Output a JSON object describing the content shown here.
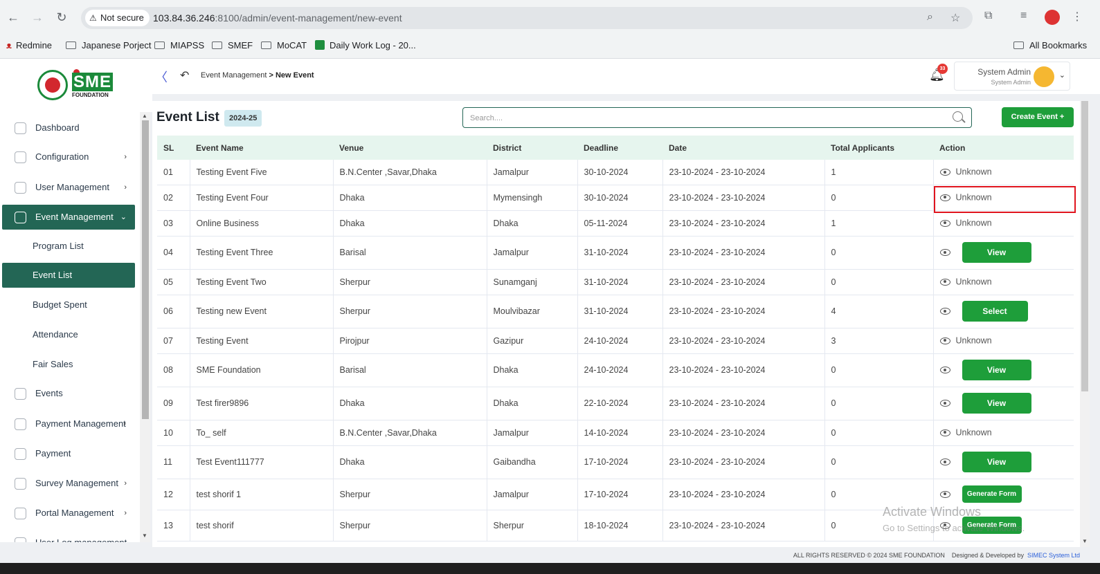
{
  "browser": {
    "not_secure": "Not secure",
    "url_host": "103.84.36.246",
    "url_path": ":8100/admin/event-management/new-event",
    "bookmarks": [
      "Redmine",
      "Japanese Porject",
      "MIAPSS",
      "SMEF",
      "MoCAT",
      "Daily Work Log - 20...",
      "All Bookmarks"
    ]
  },
  "logo": {
    "brand": "SME",
    "subtitle": "FOUNDATION"
  },
  "topbar": {
    "breadcrumb_parent": "Event Management",
    "breadcrumb_sep": ">",
    "breadcrumb_current": "New Event",
    "notification_count": "33",
    "user_name": "System Admin",
    "user_role": "System Admin"
  },
  "sidebar": {
    "items": [
      {
        "label": "Dashboard",
        "chevron": ""
      },
      {
        "label": "Configuration",
        "chevron": "›"
      },
      {
        "label": "User Management",
        "chevron": "›"
      },
      {
        "label": "Event Management",
        "chevron": "⌄"
      },
      {
        "label": "Events",
        "chevron": ""
      },
      {
        "label": "Payment Management",
        "chevron": "›"
      },
      {
        "label": "Payment",
        "chevron": ""
      },
      {
        "label": "Survey Management",
        "chevron": "›"
      },
      {
        "label": "Portal Management",
        "chevron": "›"
      },
      {
        "label": "User Log management",
        "chevron": ""
      }
    ],
    "subitems": [
      "Program List",
      "Event List",
      "Budget Spent",
      "Attendance",
      "Fair Sales"
    ]
  },
  "main": {
    "title": "Event List",
    "year_badge": "2024-25",
    "search_placeholder": "Search....",
    "create_button": "Create Event +",
    "columns": [
      "SL",
      "Event Name",
      "Venue",
      "District",
      "Deadline",
      "Date",
      "Total Applicants",
      "Action"
    ],
    "rows": [
      {
        "sl": "01",
        "name": "Testing Event Five",
        "venue": "B.N.Center ,Savar,Dhaka",
        "district": "Jamalpur",
        "deadline": "30-10-2024",
        "date": "23-10-2024 - 23-10-2024",
        "applicants": "1",
        "action": "Unknown",
        "action_type": "text"
      },
      {
        "sl": "02",
        "name": "Testing Event Four",
        "venue": "Dhaka",
        "district": "Mymensingh",
        "deadline": "30-10-2024",
        "date": "23-10-2024 - 23-10-2024",
        "applicants": "0",
        "action": "Unknown",
        "action_type": "text"
      },
      {
        "sl": "03",
        "name": "Online Business",
        "venue": "Dhaka",
        "district": "Dhaka",
        "deadline": "05-11-2024",
        "date": "23-10-2024 - 23-10-2024",
        "applicants": "1",
        "action": "Unknown",
        "action_type": "text"
      },
      {
        "sl": "04",
        "name": "Testing Event Three",
        "venue": "Barisal",
        "district": "Jamalpur",
        "deadline": "31-10-2024",
        "date": "23-10-2024 - 23-10-2024",
        "applicants": "0",
        "action": "View",
        "action_type": "button"
      },
      {
        "sl": "05",
        "name": "Testing Event Two",
        "venue": "Sherpur",
        "district": "Sunamganj",
        "deadline": "31-10-2024",
        "date": "23-10-2024 - 23-10-2024",
        "applicants": "0",
        "action": "Unknown",
        "action_type": "text"
      },
      {
        "sl": "06",
        "name": "Testing new Event",
        "venue": "Sherpur",
        "district": "Moulvibazar",
        "deadline": "31-10-2024",
        "date": "23-10-2024 - 23-10-2024",
        "applicants": "4",
        "action": "Select",
        "action_type": "button"
      },
      {
        "sl": "07",
        "name": "Testing Event",
        "venue": "Pirojpur",
        "district": "Gazipur",
        "deadline": "24-10-2024",
        "date": "23-10-2024 - 23-10-2024",
        "applicants": "3",
        "action": "Unknown",
        "action_type": "text"
      },
      {
        "sl": "08",
        "name": "SME Foundation",
        "venue": "Barisal",
        "district": "Dhaka",
        "deadline": "24-10-2024",
        "date": "23-10-2024 - 23-10-2024",
        "applicants": "0",
        "action": "View",
        "action_type": "button"
      },
      {
        "sl": "09",
        "name": "Test firer9896",
        "venue": "Dhaka",
        "district": "Dhaka",
        "deadline": "22-10-2024",
        "date": "23-10-2024 - 23-10-2024",
        "applicants": "0",
        "action": "View",
        "action_type": "button"
      },
      {
        "sl": "10",
        "name": "To_ self",
        "venue": "B.N.Center ,Savar,Dhaka",
        "district": "Jamalpur",
        "deadline": "14-10-2024",
        "date": "23-10-2024 - 23-10-2024",
        "applicants": "0",
        "action": "Unknown",
        "action_type": "text"
      },
      {
        "sl": "11",
        "name": "Test Event111777",
        "venue": "Dhaka",
        "district": "Gaibandha",
        "deadline": "17-10-2024",
        "date": "23-10-2024 - 23-10-2024",
        "applicants": "0",
        "action": "View",
        "action_type": "button"
      },
      {
        "sl": "12",
        "name": "test shorif 1",
        "venue": "Sherpur",
        "district": "Jamalpur",
        "deadline": "17-10-2024",
        "date": "23-10-2024 - 23-10-2024",
        "applicants": "0",
        "action": "Generate Form",
        "action_type": "small"
      },
      {
        "sl": "13",
        "name": "test shorif",
        "venue": "Sherpur",
        "district": "Sherpur",
        "deadline": "18-10-2024",
        "date": "23-10-2024 - 23-10-2024",
        "applicants": "0",
        "action": "Generate Form",
        "action_type": "small"
      }
    ]
  },
  "footer": {
    "rights": "ALL RIGHTS RESERVED © 2024 SME FOUNDATION",
    "designed": "Designed & Developed by",
    "company": "SIMEC System Ltd"
  },
  "watermark": {
    "line1": "Activate Windows",
    "line2": "Go to Settings to activate Windows."
  },
  "colors": {
    "primary": "#236655",
    "button_green": "#1e9e3a",
    "highlight_red": "#e0141e"
  }
}
